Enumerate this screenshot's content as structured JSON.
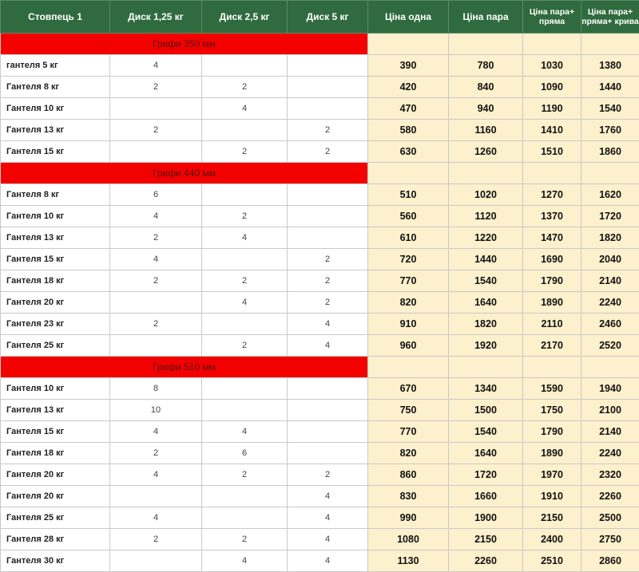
{
  "colors": {
    "header_bg": "#2f6b3e",
    "group_bg": "#f30000",
    "price_bg": "#fdf0cc"
  },
  "columns": [
    "Стовпець 1",
    "Диск 1,25 кг",
    "Диск 2,5 кг",
    "Диск 5 кг",
    "Ціна одна",
    "Ціна пара",
    "Ціна пара+ пряма",
    "Ціна пара+ пряма+ крива"
  ],
  "groups": [
    {
      "title": "Грифи 350 мм",
      "rows": [
        [
          "гантеля 5 кг",
          "4",
          "",
          "",
          "390",
          "780",
          "1030",
          "1380"
        ],
        [
          "Гантеля 8 кг",
          "2",
          "2",
          "",
          "420",
          "840",
          "1090",
          "1440"
        ],
        [
          "Гантеля 10 кг",
          "",
          "4",
          "",
          "470",
          "940",
          "1190",
          "1540"
        ],
        [
          "Гантеля 13 кг",
          "2",
          "",
          "2",
          "580",
          "1160",
          "1410",
          "1760"
        ],
        [
          "Гантеля 15 кг",
          "",
          "2",
          "2",
          "630",
          "1260",
          "1510",
          "1860"
        ]
      ]
    },
    {
      "title": "Грифи 440 мм",
      "rows": [
        [
          "Гантеля 8 кг",
          "6",
          "",
          "",
          "510",
          "1020",
          "1270",
          "1620"
        ],
        [
          "Гантеля 10 кг",
          "4",
          "2",
          "",
          "560",
          "1120",
          "1370",
          "1720"
        ],
        [
          "Гантеля 13 кг",
          "2",
          "4",
          "",
          "610",
          "1220",
          "1470",
          "1820"
        ],
        [
          "Гантеля 15 кг",
          "4",
          "",
          "2",
          "720",
          "1440",
          "1690",
          "2040"
        ],
        [
          "Гантеля 18 кг",
          "2",
          "2",
          "2",
          "770",
          "1540",
          "1790",
          "2140"
        ],
        [
          "Гантеля 20 кг",
          "",
          "4",
          "2",
          "820",
          "1640",
          "1890",
          "2240"
        ],
        [
          "Гантеля 23 кг",
          "2",
          "",
          "4",
          "910",
          "1820",
          "2110",
          "2460"
        ],
        [
          "Гантеля 25 кг",
          "",
          "2",
          "4",
          "960",
          "1920",
          "2170",
          "2520"
        ]
      ]
    },
    {
      "title": "Грифи 510 мм",
      "rows": [
        [
          "Гантеля 10 кг",
          "8",
          "",
          "",
          "670",
          "1340",
          "1590",
          "1940"
        ],
        [
          "Гантеля 13 кг",
          "10",
          "",
          "",
          "750",
          "1500",
          "1750",
          "2100"
        ],
        [
          "Гантеля 15 кг",
          "4",
          "4",
          "",
          "770",
          "1540",
          "1790",
          "2140"
        ],
        [
          "Гантеля 18 кг",
          "2",
          "6",
          "",
          "820",
          "1640",
          "1890",
          "2240"
        ],
        [
          "Гантеля 20 кг",
          "4",
          "2",
          "2",
          "860",
          "1720",
          "1970",
          "2320"
        ],
        [
          "Гантеля 20 кг",
          "",
          "",
          "4",
          "830",
          "1660",
          "1910",
          "2260"
        ],
        [
          "Гантеля 25 кг",
          "4",
          "",
          "4",
          "990",
          "1900",
          "2150",
          "2500"
        ],
        [
          "Гантеля 28 кг",
          "2",
          "2",
          "4",
          "1080",
          "2150",
          "2400",
          "2750"
        ],
        [
          "Гантеля 30 кг",
          "",
          "4",
          "4",
          "1130",
          "2260",
          "2510",
          "2860"
        ]
      ]
    }
  ]
}
